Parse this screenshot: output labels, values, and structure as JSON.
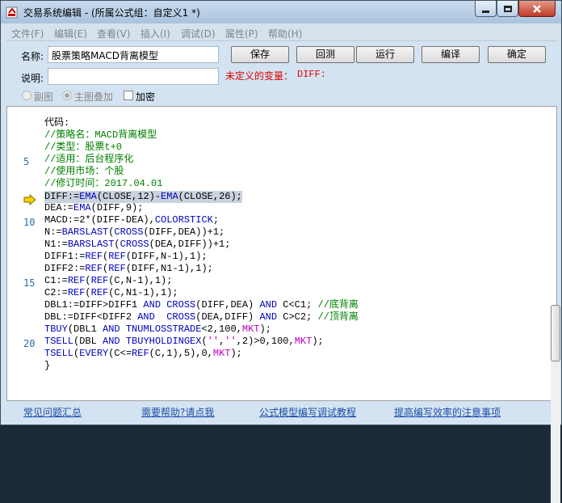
{
  "window": {
    "title": "交易系统编辑 - (所属公式组：自定义1 *)",
    "controls": [
      "minimize-icon",
      "maximize-icon",
      "close-icon"
    ]
  },
  "menu": [
    "文件(F)",
    "编辑(E)",
    "查看(V)",
    "插入(I)",
    "调试(D)",
    "属性(P)",
    "帮助(H)"
  ],
  "form": {
    "name_label": "名称:",
    "name_value": "股票策略MACD背离模型",
    "desc_label": "说明:",
    "desc_value": "",
    "undefined_label": "未定义的变量：",
    "undefined_value": "DIFF:",
    "buttons": [
      "保存",
      "回测",
      "运行",
      "编译",
      "确定"
    ],
    "radio_sub": "副图",
    "radio_main": "主图叠加",
    "encrypt": "加密"
  },
  "editor": {
    "line_numbers": [
      "5",
      "10",
      "15",
      "20"
    ],
    "lines": [
      "代码:",
      "//策略名：MACD背离模型",
      "//类型：股票t+0",
      "//适用：后台程序化",
      "//使用市场：个股",
      "//修订时间：2017.04.01",
      "DIFF:=EMA(CLOSE,12)-EMA(CLOSE,26);",
      "DEA:=EMA(DIFF,9);",
      "MACD:=2*(DIFF-DEA),COLORSTICK;",
      "N:=BARSLAST(CROSS(DIFF,DEA))+1;",
      "N1:=BARSLAST(CROSS(DEA,DIFF))+1;",
      "DIFF1:=REF(REF(DIFF,N-1),1);",
      "DIFF2:=REF(REF(DIFF,N1-1),1);",
      "C1:=REF(REF(C,N-1),1);",
      "C2:=REF(REF(C,N1-1),1);",
      "DBL1:=DIFF>DIFF1 AND CROSS(DIFF,DEA) AND C<C1; //底背离",
      "DBL:=DIFF<DIFF2 AND  CROSS(DEA,DIFF) AND C>C2; //顶背离",
      "TBUY(DBL1 AND TNUMLOSSTRADE<2,100,MKT);",
      "TSELL(DBL AND TBUYHOLDINGEX('','',2)>0,100,MKT);",
      "TSELL(EVERY(C<=REF(C,1),5),0,MKT);",
      "}"
    ]
  },
  "footer_links": [
    "常见问题汇总",
    "需要帮助?请点我",
    "公式模型编写调试教程",
    "提高编写效率的注意事项"
  ]
}
